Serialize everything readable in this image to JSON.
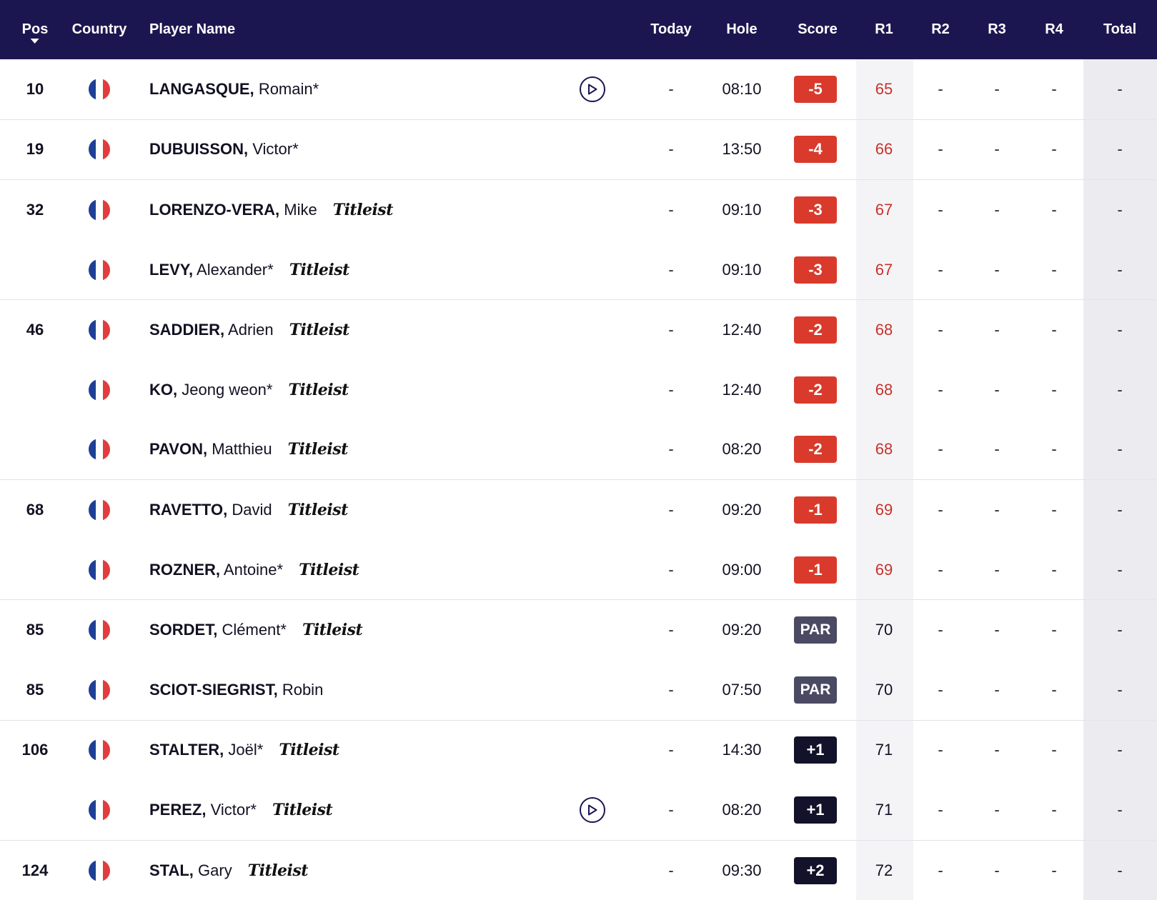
{
  "header": {
    "pos": "Pos",
    "country": "Country",
    "player": "Player Name",
    "today": "Today",
    "hole": "Hole",
    "score": "Score",
    "r1": "R1",
    "r2": "R2",
    "r3": "R3",
    "r4": "R4",
    "total": "Total"
  },
  "colors": {
    "header_bg": "#1c1650",
    "under_par": "#d93a2b",
    "par": "#4a4a63",
    "over_par": "#12122a",
    "flag_blue": "#1d3f95",
    "flag_white": "#ffffff",
    "flag_red": "#e23c3c"
  },
  "icons": {
    "sort": "caret-down-icon",
    "play": "play-circle-icon",
    "flag": "france-flag-icon"
  },
  "rows": [
    {
      "pos": "10",
      "last": "LANGASQUE,",
      "first": "Romain*",
      "brand": "",
      "play": true,
      "today": "-",
      "hole": "08:10",
      "score": "-5",
      "status": "under",
      "r1": "65",
      "r2": "-",
      "r3": "-",
      "r4": "-",
      "total": "-",
      "sep": false
    },
    {
      "pos": "19",
      "last": "DUBUISSON,",
      "first": "Victor*",
      "brand": "",
      "play": false,
      "today": "-",
      "hole": "13:50",
      "score": "-4",
      "status": "under",
      "r1": "66",
      "r2": "-",
      "r3": "-",
      "r4": "-",
      "total": "-",
      "sep": true
    },
    {
      "pos": "32",
      "last": "LORENZO-VERA,",
      "first": "Mike",
      "brand": "Titleist",
      "play": false,
      "today": "-",
      "hole": "09:10",
      "score": "-3",
      "status": "under",
      "r1": "67",
      "r2": "-",
      "r3": "-",
      "r4": "-",
      "total": "-",
      "sep": true
    },
    {
      "pos": "",
      "last": "LEVY,",
      "first": "Alexander*",
      "brand": "Titleist",
      "play": false,
      "today": "-",
      "hole": "09:10",
      "score": "-3",
      "status": "under",
      "r1": "67",
      "r2": "-",
      "r3": "-",
      "r4": "-",
      "total": "-",
      "sep": false
    },
    {
      "pos": "46",
      "last": "SADDIER,",
      "first": "Adrien",
      "brand": "Titleist",
      "play": false,
      "today": "-",
      "hole": "12:40",
      "score": "-2",
      "status": "under",
      "r1": "68",
      "r2": "-",
      "r3": "-",
      "r4": "-",
      "total": "-",
      "sep": true
    },
    {
      "pos": "",
      "last": "KO,",
      "first": "Jeong weon*",
      "brand": "Titleist",
      "play": false,
      "today": "-",
      "hole": "12:40",
      "score": "-2",
      "status": "under",
      "r1": "68",
      "r2": "-",
      "r3": "-",
      "r4": "-",
      "total": "-",
      "sep": false
    },
    {
      "pos": "",
      "last": "PAVON,",
      "first": "Matthieu",
      "brand": "Titleist",
      "play": false,
      "today": "-",
      "hole": "08:20",
      "score": "-2",
      "status": "under",
      "r1": "68",
      "r2": "-",
      "r3": "-",
      "r4": "-",
      "total": "-",
      "sep": false
    },
    {
      "pos": "68",
      "last": "RAVETTO,",
      "first": "David",
      "brand": "Titleist",
      "play": false,
      "today": "-",
      "hole": "09:20",
      "score": "-1",
      "status": "under",
      "r1": "69",
      "r2": "-",
      "r3": "-",
      "r4": "-",
      "total": "-",
      "sep": true
    },
    {
      "pos": "",
      "last": "ROZNER,",
      "first": "Antoine*",
      "brand": "Titleist",
      "play": false,
      "today": "-",
      "hole": "09:00",
      "score": "-1",
      "status": "under",
      "r1": "69",
      "r2": "-",
      "r3": "-",
      "r4": "-",
      "total": "-",
      "sep": false
    },
    {
      "pos": "85",
      "last": "SORDET,",
      "first": "Clément*",
      "brand": "Titleist",
      "play": false,
      "today": "-",
      "hole": "09:20",
      "score": "PAR",
      "status": "par",
      "r1": "70",
      "r2": "-",
      "r3": "-",
      "r4": "-",
      "total": "-",
      "sep": true
    },
    {
      "pos": "85",
      "last": "SCIOT-SIEGRIST,",
      "first": "Robin",
      "brand": "",
      "play": false,
      "today": "-",
      "hole": "07:50",
      "score": "PAR",
      "status": "par",
      "r1": "70",
      "r2": "-",
      "r3": "-",
      "r4": "-",
      "total": "-",
      "sep": false
    },
    {
      "pos": "106",
      "last": "STALTER,",
      "first": "Joël*",
      "brand": "Titleist",
      "play": false,
      "today": "-",
      "hole": "14:30",
      "score": "+1",
      "status": "over",
      "r1": "71",
      "r2": "-",
      "r3": "-",
      "r4": "-",
      "total": "-",
      "sep": true
    },
    {
      "pos": "",
      "last": "PEREZ,",
      "first": "Victor*",
      "brand": "Titleist",
      "play": true,
      "today": "-",
      "hole": "08:20",
      "score": "+1",
      "status": "over",
      "r1": "71",
      "r2": "-",
      "r3": "-",
      "r4": "-",
      "total": "-",
      "sep": false
    },
    {
      "pos": "124",
      "last": "STAL,",
      "first": "Gary",
      "brand": "Titleist",
      "play": false,
      "today": "-",
      "hole": "09:30",
      "score": "+2",
      "status": "over",
      "r1": "72",
      "r2": "-",
      "r3": "-",
      "r4": "-",
      "total": "-",
      "sep": true
    }
  ]
}
